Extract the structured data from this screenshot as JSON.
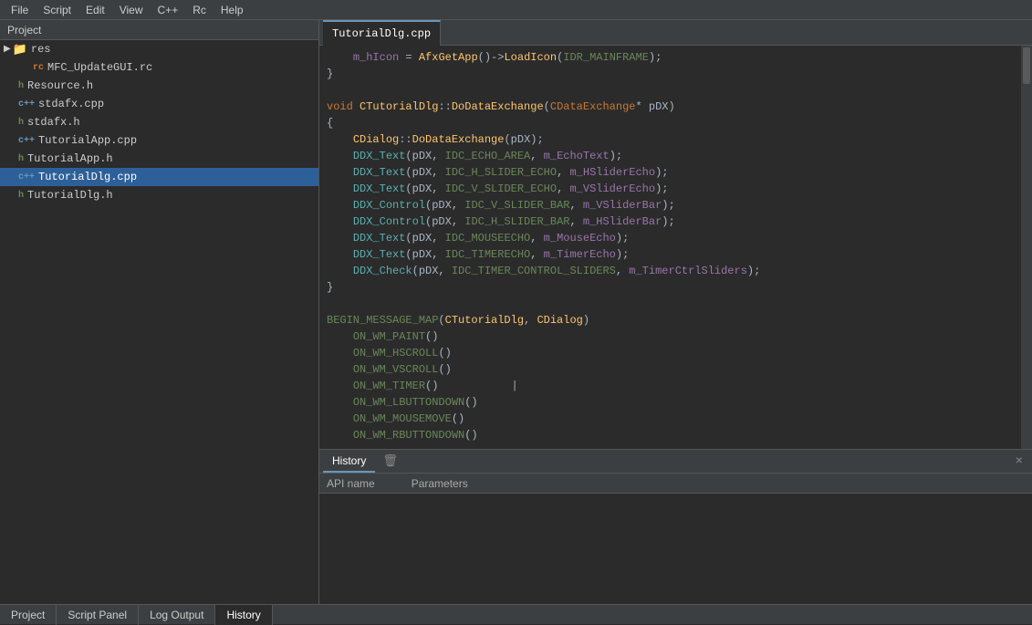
{
  "menubar": {
    "items": [
      "File",
      "Script",
      "Edit",
      "View",
      "C++",
      "Rc",
      "Help"
    ]
  },
  "sidebar": {
    "title": "Project",
    "items": [
      {
        "label": "res",
        "type": "folder",
        "indent": 1,
        "expanded": true
      },
      {
        "label": "MFC_UpdateGUI.rc",
        "type": "rc",
        "indent": 2
      },
      {
        "label": "Resource.h",
        "type": "h",
        "indent": 1
      },
      {
        "label": "stdafx.cpp",
        "type": "cpp",
        "indent": 1
      },
      {
        "label": "stdafx.h",
        "type": "h",
        "indent": 1
      },
      {
        "label": "TutorialApp.cpp",
        "type": "cpp",
        "indent": 1
      },
      {
        "label": "TutorialApp.h",
        "type": "h",
        "indent": 1
      },
      {
        "label": "TutorialDlg.cpp",
        "type": "cpp",
        "indent": 1,
        "selected": true
      },
      {
        "label": "TutorialDlg.h",
        "type": "h",
        "indent": 1
      }
    ]
  },
  "editor": {
    "active_tab": "TutorialDlg.cpp",
    "tabs": [
      "TutorialDlg.cpp"
    ]
  },
  "code": {
    "lines": [
      "    m_hIcon = AfxGetApp()->LoadIcon(IDR_MAINFRAME);",
      "}",
      "",
      "void CTutorialDlg::DoDataExchange(CDataExchange* pDX)",
      "{",
      "    CDialog::DoDataExchange(pDX);",
      "    DDX_Text(pDX, IDC_ECHO_AREA, m_EchoText);",
      "    DDX_Text(pDX, IDC_H_SLIDER_ECHO, m_HSliderEcho);",
      "    DDX_Text(pDX, IDC_V_SLIDER_ECHO, m_VSliderEcho);",
      "    DDX_Control(pDX, IDC_V_SLIDER_BAR, m_VSliderBar);",
      "    DDX_Control(pDX, IDC_H_SLIDER_BAR, m_HSliderBar);",
      "    DDX_Text(pDX, IDC_MOUSEECHO, m_MouseEcho);",
      "    DDX_Text(pDX, IDC_TIMERECHO, m_TimerEcho);",
      "    DDX_Check(pDX, IDC_TIMER_CONTROL_SLIDERS, m_TimerCtrlSliders);",
      "}",
      "",
      "BEGIN_MESSAGE_MAP(CTutorialDlg, CDialog)",
      "    ON_WM_PAINT()",
      "    ON_WM_HSCROLL()",
      "    ON_WM_VSCROLL()",
      "    ON_WM_TIMER()",
      "    ON_WM_LBUTTONDOWN()",
      "    ON_WM_MOUSEMOVE()",
      "    ON_WM_RBUTTONDOWN()"
    ]
  },
  "history_panel": {
    "tab_label": "History",
    "tab_icon": "trash-icon",
    "columns": [
      "API name",
      "Parameters"
    ],
    "close_label": "×"
  },
  "bottom_tabs": {
    "items": [
      {
        "label": "Project",
        "active": false
      },
      {
        "label": "Script Panel",
        "active": false
      },
      {
        "label": "Log Output",
        "active": false
      },
      {
        "label": "History",
        "active": true
      }
    ]
  }
}
